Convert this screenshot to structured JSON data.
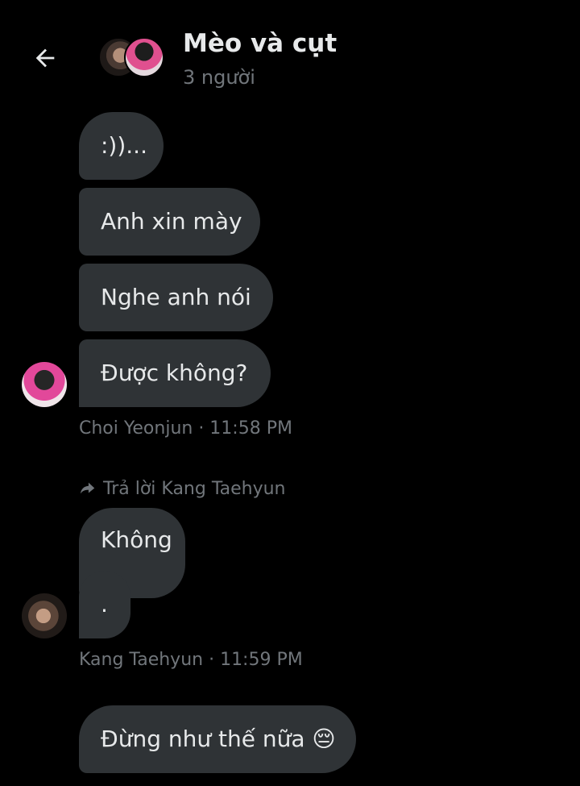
{
  "header": {
    "title": "Mèo và cụt",
    "subtitle": "3 người"
  },
  "messages": {
    "group1": [
      ":))...",
      "Anh xin mày",
      "Nghe anh nói",
      "Được không?"
    ],
    "group1_meta": "Choi Yeonjun · 11:58 PM",
    "reply_label": "Trả lời Kang Taehyun",
    "group2": [
      "Không",
      "."
    ],
    "group2_meta": "Kang Taehyun · 11:59 PM",
    "group3": [
      "Đừng như thế nữa 😔"
    ]
  },
  "colors": {
    "background": "#000000",
    "bubble": "#2f3336",
    "text": "#e7e9ea",
    "muted": "#71767b"
  },
  "icons": {
    "back": "back-arrow-icon",
    "reply": "reply-arrow-icon"
  }
}
